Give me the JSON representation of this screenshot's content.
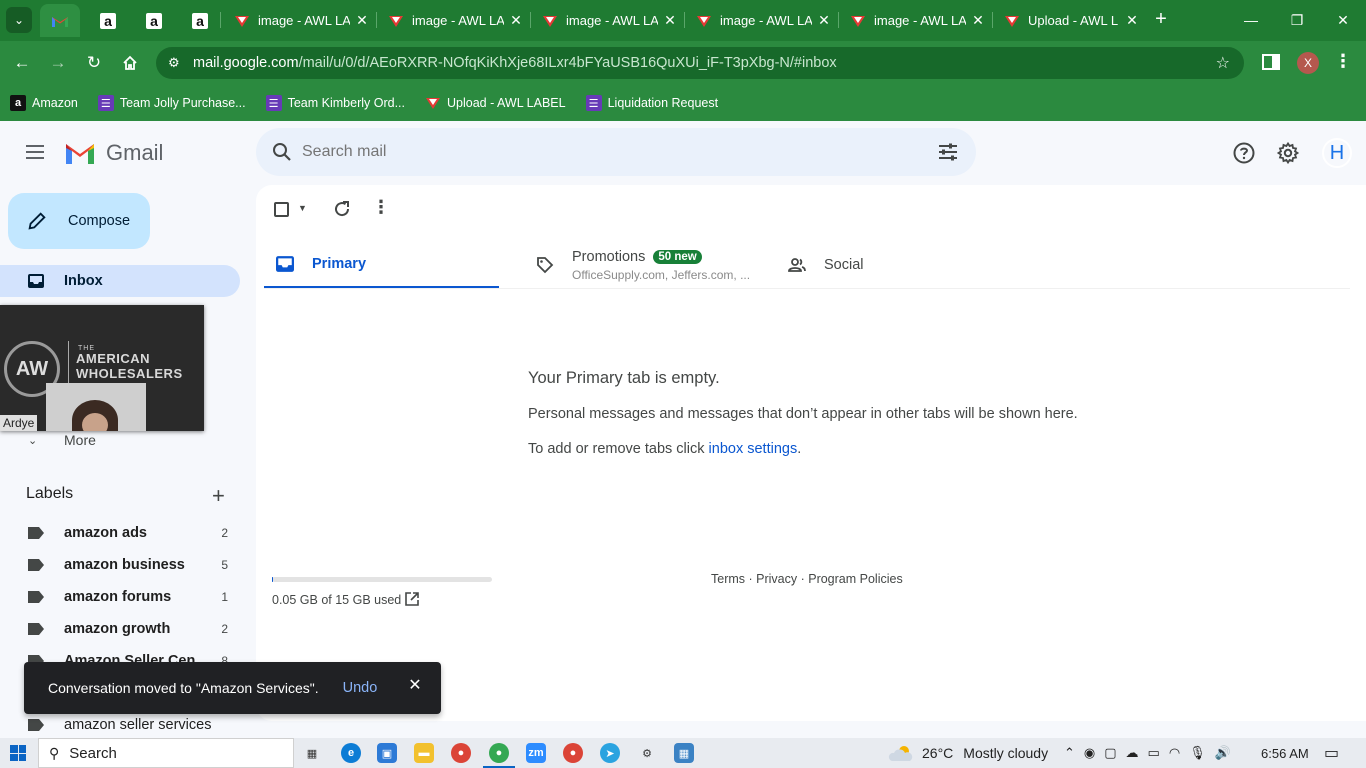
{
  "browser": {
    "tabs": [
      {
        "title": "",
        "favicon": "gmail-icon",
        "active": true
      },
      {
        "title": "",
        "favicon": "amazon-icon"
      },
      {
        "title": "",
        "favicon": "amazon-icon"
      },
      {
        "title": "",
        "favicon": "amazon-icon"
      },
      {
        "title": "image - AWL LA",
        "favicon": "awl-icon"
      },
      {
        "title": "image - AWL LA",
        "favicon": "awl-icon"
      },
      {
        "title": "image - AWL LA",
        "favicon": "awl-icon"
      },
      {
        "title": "image - AWL LA",
        "favicon": "awl-icon"
      },
      {
        "title": "image - AWL LA",
        "favicon": "awl-icon"
      },
      {
        "title": "Upload - AWL L",
        "favicon": "awl-icon"
      }
    ],
    "url_host": "mail.google.com",
    "url_path": "/mail/u/0/d/AEoRXRR-NOfqKiKhXje68ILxr4bFYaUSB16QuXUi_iF-T3pXbg-N/#inbox",
    "profile_initial": "X",
    "bookmarks": [
      {
        "label": "Amazon",
        "icon": "amazon-icon"
      },
      {
        "label": "Team Jolly Purchase...",
        "icon": "forms-icon"
      },
      {
        "label": "Team Kimberly Ord...",
        "icon": "forms-icon"
      },
      {
        "label": "Upload - AWL LABEL",
        "icon": "awl-icon"
      },
      {
        "label": "Liquidation Request",
        "icon": "forms-icon"
      }
    ]
  },
  "gmail": {
    "brand": "Gmail",
    "search_placeholder": "Search mail",
    "avatar_initial": "H",
    "compose_label": "Compose",
    "inbox_label": "Inbox",
    "more_label": "More",
    "video": {
      "brand_the": "THE",
      "brand_line1": "AMERICAN",
      "brand_line2": "WHOLESALERS",
      "logo_text": "AW",
      "participant": "Ardye"
    },
    "labels_heading": "Labels",
    "labels": [
      {
        "name": "amazon ads",
        "count": "2",
        "bold": true
      },
      {
        "name": "amazon business",
        "count": "5",
        "bold": true
      },
      {
        "name": "amazon forums",
        "count": "1",
        "bold": true
      },
      {
        "name": "amazon growth",
        "count": "2",
        "bold": true
      },
      {
        "name": "Amazon Seller Cen...",
        "count": "8",
        "bold": true
      },
      {
        "name": "amazon seller services",
        "count": "",
        "bold": false
      }
    ],
    "tabs": {
      "primary": "Primary",
      "promotions": "Promotions",
      "promotions_badge": "50 new",
      "promotions_senders": "OfficeSupply.com, Jeffers.com, ...",
      "social": "Social"
    },
    "empty": {
      "heading": "Your Primary tab is empty.",
      "body": "Personal messages and messages that don’t appear in other tabs will be shown here.",
      "settings_prefix": "To add or remove tabs click ",
      "settings_link": "inbox settings",
      "settings_suffix": "."
    },
    "storage": {
      "used_text": "0.05 GB of 15 GB used",
      "fraction_used": 0.0033
    },
    "footer": {
      "terms": "Terms",
      "privacy": "Privacy",
      "policies": "Program Policies",
      "sep": " · "
    },
    "snackbar": {
      "message": "Conversation moved to \"Amazon Services\".",
      "undo": "Undo"
    }
  },
  "taskbar": {
    "search_placeholder": "Search",
    "temperature": "26°C",
    "weather": "Mostly cloudy",
    "time": "6:56 AM"
  },
  "colors": {
    "chrome_frame": "#1f7b32",
    "gmail_selected": "#d3e3fd",
    "compose_bg": "#c2e7ff",
    "primary_blue": "#0b57d0",
    "badge_green": "#188038"
  }
}
